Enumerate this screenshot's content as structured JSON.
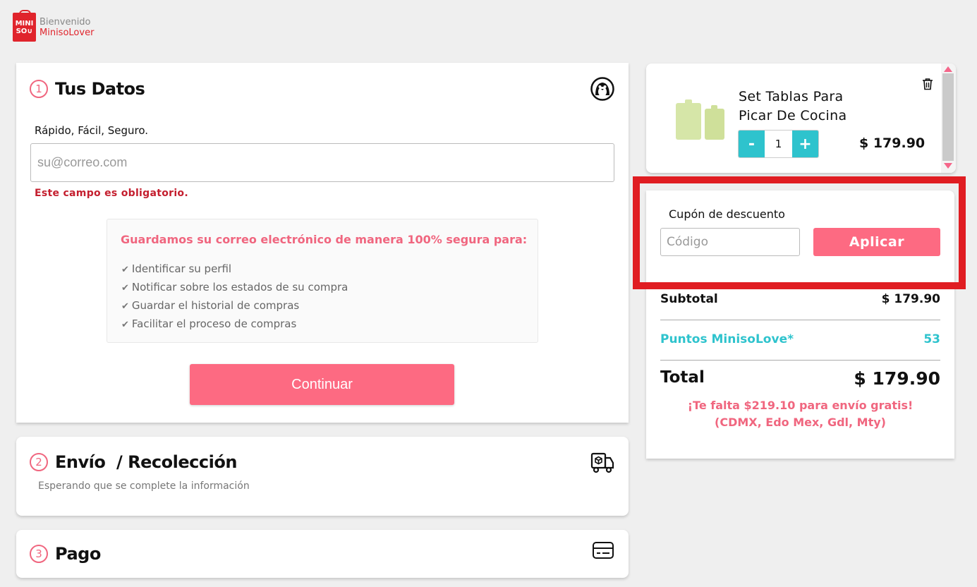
{
  "header": {
    "logo_line1": "MINI",
    "logo_line2": "SO",
    "greeting": "Bienvenido",
    "user": "MinisoLover"
  },
  "steps": [
    {
      "number": "1",
      "title": "Tus Datos",
      "icon": "penguin-icon"
    },
    {
      "number": "2",
      "title": "Envío  / Recolección",
      "icon": "delivery-truck-icon",
      "subtitle": "Esperando que se complete la información"
    },
    {
      "number": "3",
      "title": "Pago",
      "icon": "credit-card-icon"
    }
  ],
  "datos": {
    "tagline": "Rápido, Fácil, Seguro.",
    "email_placeholder": "su@correo.com",
    "error": "Este campo es obligatorio.",
    "info_title": "Guardamos su correo electrónico de manera 100% segura para:",
    "info_items": [
      "Identificar su perfil",
      "Notificar sobre los estados de su compra",
      "Guardar el historial de compras",
      "Facilitar el proceso de compras"
    ],
    "continue_label": "Continuar"
  },
  "cart": {
    "product_name_line1": "Set Tablas Para",
    "product_name_line2": "Picar De Cocina",
    "quantity": "1",
    "minus": "-",
    "plus": "+",
    "price": "$ 179.90"
  },
  "summary": {
    "coupon_label": "Cupón de descuento",
    "coupon_placeholder": "Código",
    "apply_label": "Aplicar",
    "subtotal_label": "Subtotal",
    "subtotal_value": "$ 179.90",
    "points_label": "Puntos MinisoLove*",
    "points_value": "53",
    "total_label": "Total",
    "total_value": "$ 179.90",
    "free_shipping_line1": "¡Te falta $219.10 para envío gratis!",
    "free_shipping_line2": "(CDMX, Edo Mex, Gdl, Mty)"
  },
  "colors": {
    "accent_pink": "#fd6a82",
    "teal": "#2ec3cd",
    "error_red": "#c41e2e",
    "highlight_red": "#e01d22",
    "brand_red": "#e0242c"
  }
}
